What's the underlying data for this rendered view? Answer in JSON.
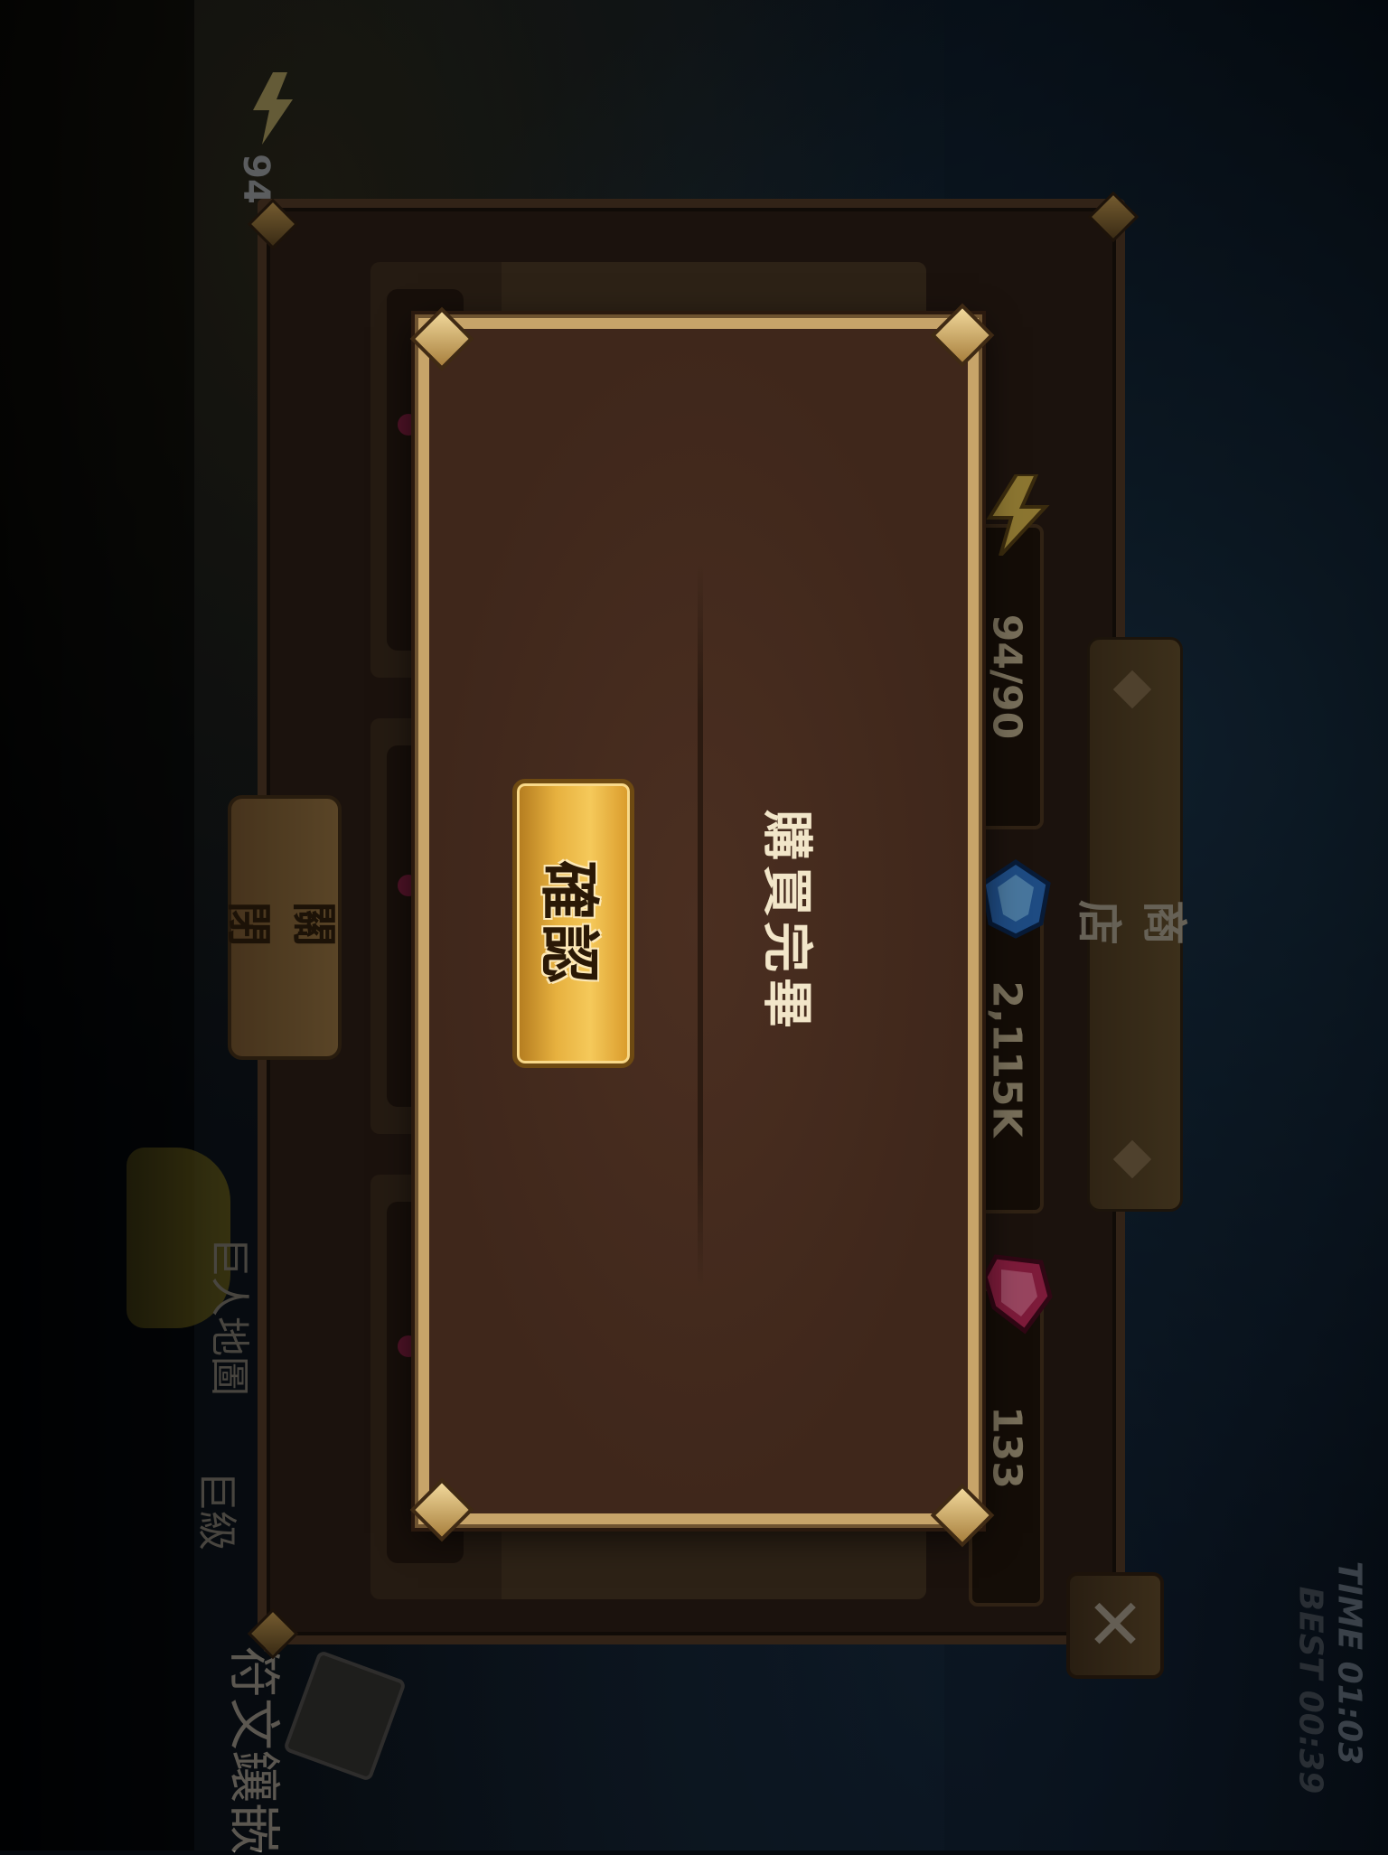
{
  "hud": {
    "energy_value": "94",
    "time_label": "TIME 01:03",
    "best_label": "BEST 00:39",
    "menu_item_1": "巨人地圖",
    "menu_item_2": "巨級",
    "menu_item_3": "符文鑲嵌"
  },
  "shop": {
    "title": "商店",
    "close_label": "關閉",
    "currencies": [
      {
        "icon": "lightning-energy-icon",
        "value": "94/90"
      },
      {
        "icon": "blue-crystal-icon",
        "value": "2,115K"
      },
      {
        "icon": "red-crystal-icon",
        "value": "133"
      }
    ]
  },
  "modal": {
    "message": "購買完畢",
    "confirm_label": "確認"
  },
  "close_glyph": "✕",
  "colors": {
    "modal_border": "#c7a469",
    "modal_bg": "#42291d",
    "confirm_gold": "#e7b13f",
    "text_cream": "#f2e6c9"
  }
}
